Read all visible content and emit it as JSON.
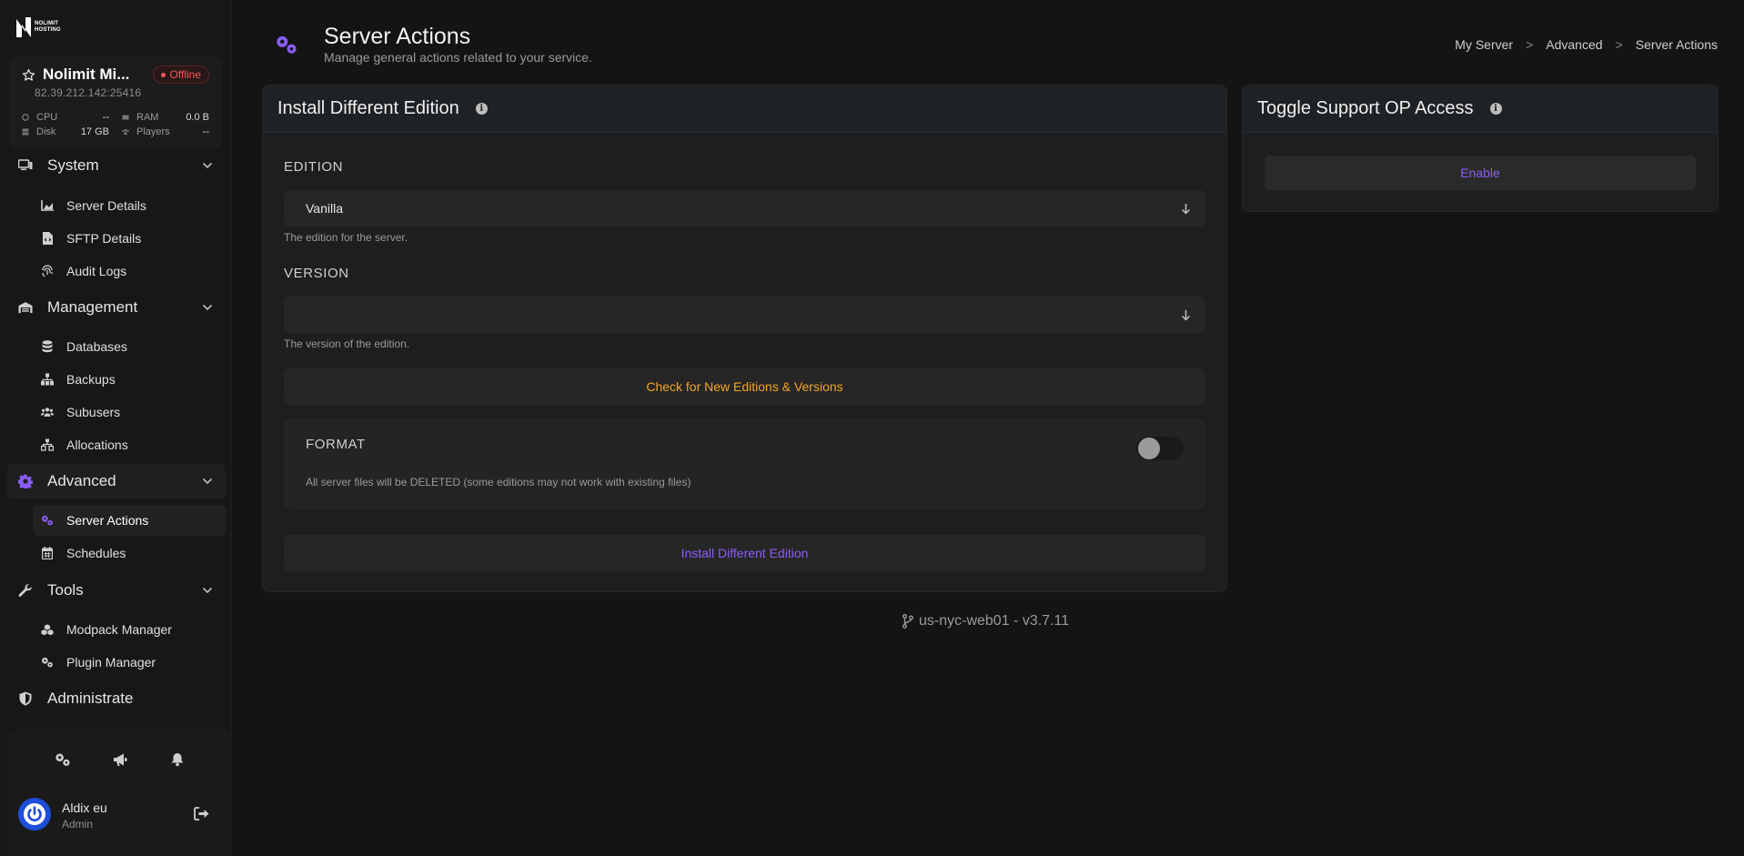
{
  "brand": {
    "logo_line1": "NOLIMIT",
    "logo_line2": "HOSTING"
  },
  "server": {
    "name": "Nolimit Mi...",
    "ip": "82.39.212.142:25416",
    "status": "Offline",
    "stats": {
      "cpu_label": "CPU",
      "cpu_value": "--",
      "ram_label": "RAM",
      "ram_value": "0.0 B",
      "disk_label": "Disk",
      "disk_value": "17 GB",
      "players_label": "Players",
      "players_value": "--"
    }
  },
  "nav": {
    "system": {
      "label": "System",
      "items": [
        "Server Details",
        "SFTP Details",
        "Audit Logs"
      ]
    },
    "management": {
      "label": "Management",
      "items": [
        "Databases",
        "Backups",
        "Subusers",
        "Allocations"
      ]
    },
    "advanced": {
      "label": "Advanced",
      "items": [
        "Server Actions",
        "Schedules"
      ]
    },
    "tools": {
      "label": "Tools",
      "items": [
        "Modpack Manager",
        "Plugin Manager"
      ]
    },
    "administrate": {
      "label": "Administrate"
    }
  },
  "user": {
    "name": "Aldix eu",
    "role": "Admin"
  },
  "header": {
    "title": "Server Actions",
    "subtitle": "Manage general actions related to your service.",
    "breadcrumb": [
      "My Server",
      "Advanced",
      "Server Actions"
    ],
    "breadcrumb_sep": ">"
  },
  "edition_card": {
    "title": "Install Different Edition",
    "edition_label": "EDITION",
    "edition_value": "Vanilla",
    "edition_help": "The edition for the server.",
    "version_label": "VERSION",
    "version_value": "",
    "version_help": "The version of the edition.",
    "check_button": "Check for New Editions & Versions",
    "format_label": "FORMAT",
    "format_enabled": false,
    "format_note": "All server files will be DELETED (some editions may not work with existing files)",
    "install_button": "Install Different Edition"
  },
  "op_card": {
    "title": "Toggle Support OP Access",
    "button": "Enable"
  },
  "footer": {
    "version": "us-nyc-web01 - v3.7.11"
  },
  "colors": {
    "accent": "#8b5cf6",
    "warning": "#f5a524",
    "offline": "#f05a5a",
    "avatar": "#1d4ed8"
  }
}
